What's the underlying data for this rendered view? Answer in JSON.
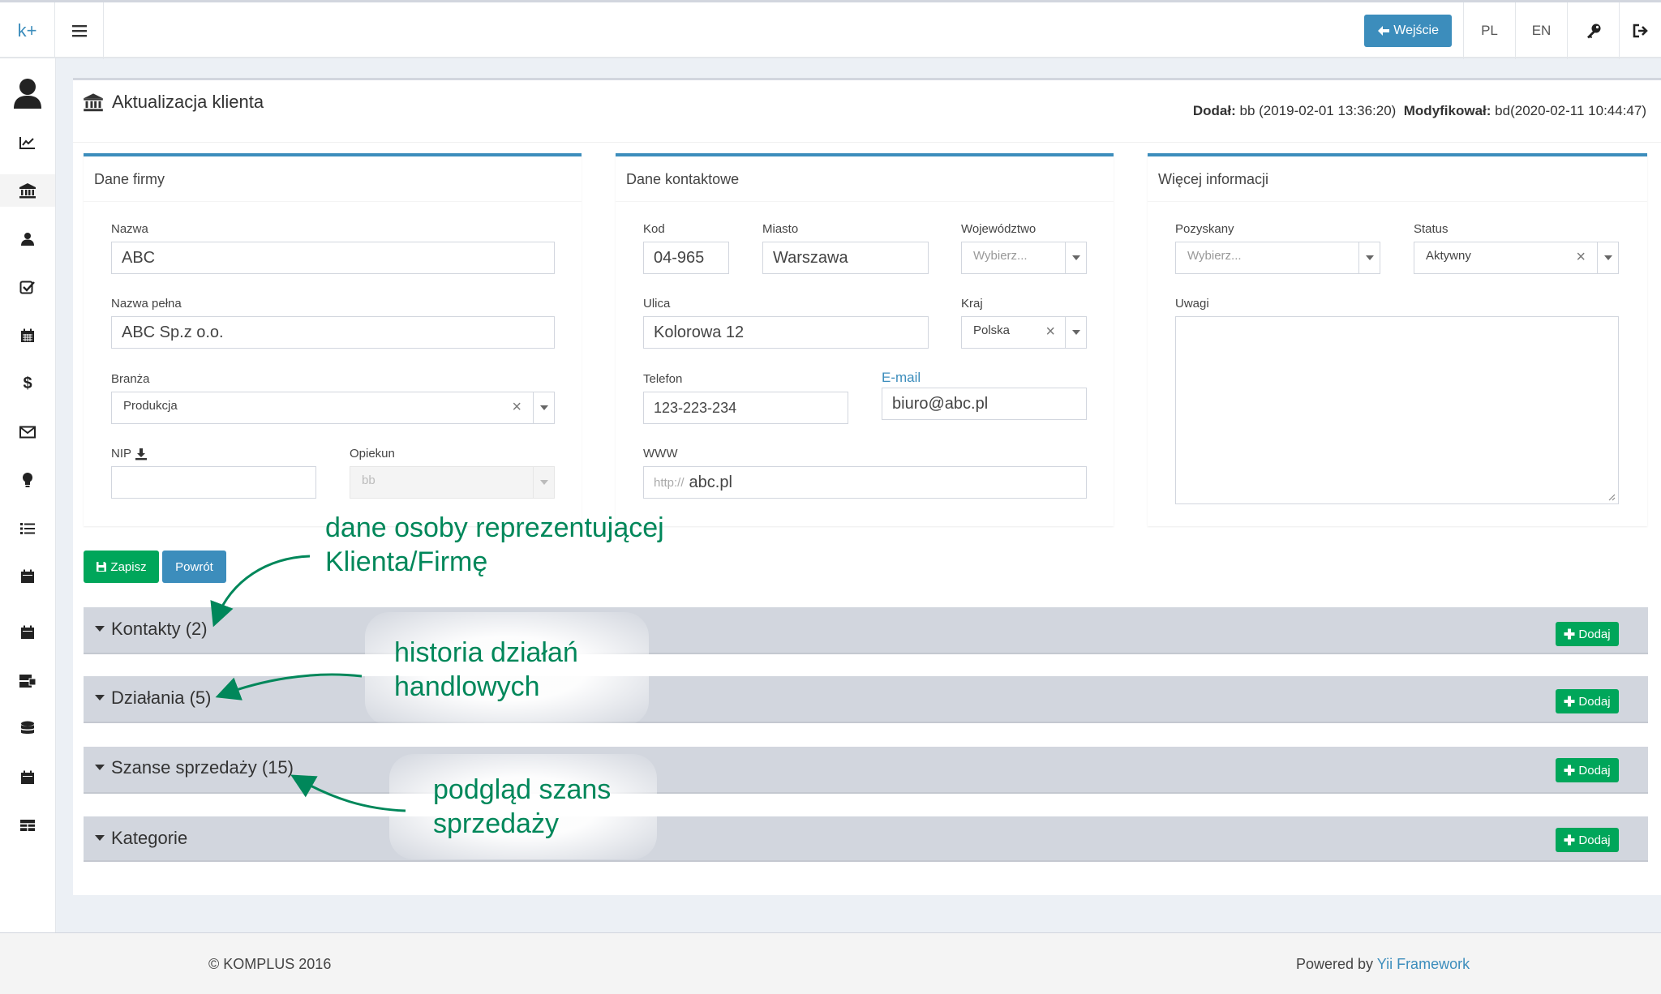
{
  "brand": {
    "logo": "k+"
  },
  "topbar": {
    "login_label": "Wejście",
    "lang_pl": "PL",
    "lang_en": "EN",
    "key_icon": "key-icon",
    "logout_icon": "logout-icon"
  },
  "sidebar": {
    "items": [
      "user-icon",
      "line-chart-icon",
      "bank-icon",
      "users-icon",
      "task-check-icon",
      "calendar-icon",
      "dollar-icon",
      "envelope-icon",
      "lightbulb-icon",
      "list-icon",
      "calendar-icon",
      "calendar-icon",
      "server-icon",
      "database-icon",
      "calendar-icon",
      "table-icon"
    ]
  },
  "page": {
    "title": "Aktualizacja klienta",
    "added_label": "Dodał:",
    "added_value": "bb (2019-02-01 13:36:20)",
    "modified_label": "Modyfikował:",
    "modified_value": "bd(2020-02-11 10:44:47)"
  },
  "company": {
    "title": "Dane firmy",
    "name_label": "Nazwa",
    "name_value": "ABC",
    "fullname_label": "Nazwa pełna",
    "fullname_value": "ABC Sp.z o.o.",
    "industry_label": "Branża",
    "industry_value": "Produkcja",
    "nip_label": "NIP",
    "nip_value": "",
    "owner_label": "Opiekun",
    "owner_value": "bb"
  },
  "contact": {
    "title": "Dane kontaktowe",
    "code_label": "Kod",
    "code_value": "04-965",
    "city_label": "Miasto",
    "city_value": "Warszawa",
    "province_label": "Województwo",
    "province_placeholder": "Wybierz...",
    "street_label": "Ulica",
    "street_value": "Kolorowa 12",
    "country_label": "Kraj",
    "country_value": "Polska",
    "phone_label": "Telefon",
    "phone_value": "123-223-234",
    "email_label": "E-mail",
    "email_value": "biuro@abc.pl",
    "www_label": "WWW",
    "www_prefix": "http://",
    "www_value": "abc.pl"
  },
  "more": {
    "title": "Więcej informacji",
    "acquired_label": "Pozyskany",
    "acquired_placeholder": "Wybierz...",
    "status_label": "Status",
    "status_value": "Aktywny",
    "notes_label": "Uwagi"
  },
  "actions": {
    "save_label": "Zapisz",
    "back_label": "Powrót"
  },
  "sections": [
    {
      "title": "Kontakty (2)",
      "add_label": "Dodaj"
    },
    {
      "title": "Działania (5)",
      "add_label": "Dodaj"
    },
    {
      "title": "Szanse sprzedaży (15)",
      "add_label": "Dodaj"
    },
    {
      "title": "Kategorie",
      "add_label": "Dodaj"
    }
  ],
  "annotations": {
    "a1_line1": "dane osoby reprezentującej",
    "a1_line2": "Klienta/Firmę",
    "a2_line1": "historia działań",
    "a2_line2": "handlowych",
    "a3_line1": "podgląd szans",
    "a3_line2": "sprzedaży",
    "color": "#00875a"
  },
  "footer": {
    "copyright": "© KOMPLUS 2016",
    "powered_prefix": "Powered by ",
    "powered_link": "Yii Framework"
  },
  "colors": {
    "primary": "#3c8dbc",
    "success": "#00a65a",
    "accordion": "#d2d6de"
  }
}
